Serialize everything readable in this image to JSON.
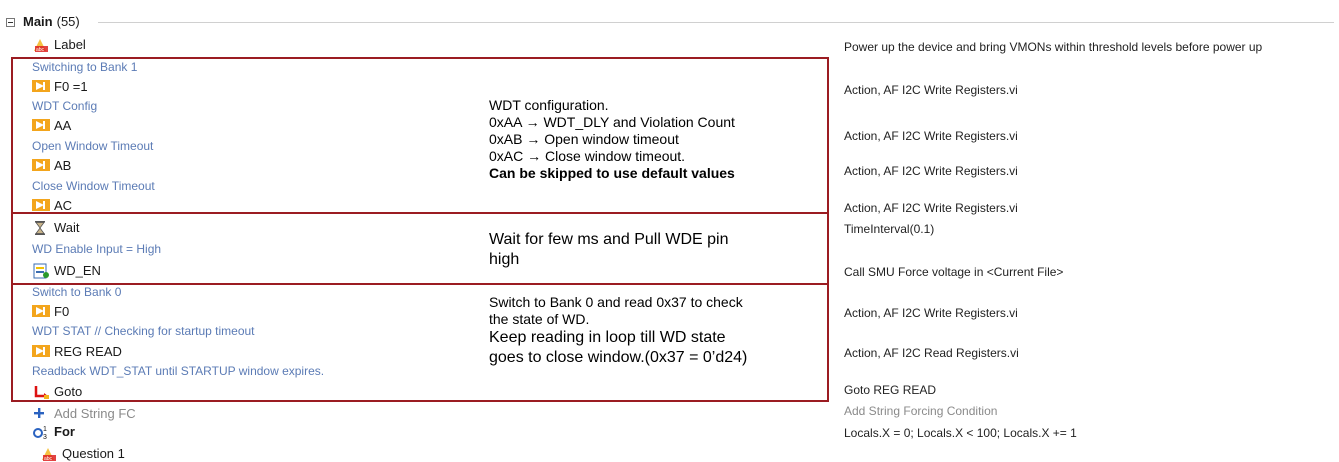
{
  "tree": {
    "top_partial_text": "",
    "main": {
      "label": "Main",
      "count": "(55)"
    },
    "rows": [
      {
        "id": "label",
        "type": "step",
        "icon": "label-icon",
        "text": "Label",
        "right": "Power up the device and bring VMONs within threshold levels before power up"
      },
      {
        "id": "c1",
        "type": "comment",
        "text": "Switching to Bank 1"
      },
      {
        "id": "f0-1",
        "type": "step",
        "icon": "action-icon",
        "text": "F0 =1",
        "right": "Action,  AF I2C Write Registers.vi"
      },
      {
        "id": "c2",
        "type": "comment",
        "text": "WDT Config"
      },
      {
        "id": "aa",
        "type": "step",
        "icon": "action-icon",
        "text": "AA",
        "right": "Action,  AF I2C Write Registers.vi"
      },
      {
        "id": "c3",
        "type": "comment",
        "text": "Open Window Timeout"
      },
      {
        "id": "ab",
        "type": "step",
        "icon": "action-icon",
        "text": "AB",
        "right": "Action,  AF I2C Write Registers.vi"
      },
      {
        "id": "c4",
        "type": "comment",
        "text": "Close Window Timeout"
      },
      {
        "id": "ac",
        "type": "step",
        "icon": "action-icon",
        "text": "AC",
        "right": "Action,  AF I2C Write Registers.vi"
      },
      {
        "id": "wait",
        "type": "step",
        "icon": "hourglass-icon",
        "text": "Wait",
        "right": "TimeInterval(0.1)"
      },
      {
        "id": "c5",
        "type": "comment",
        "text": "WD Enable Input = High"
      },
      {
        "id": "wden",
        "type": "step",
        "icon": "smu-icon",
        "text": "WD_EN",
        "right": "Call SMU Force voltage in <Current File>"
      },
      {
        "id": "c6",
        "type": "comment",
        "text": "Switch to Bank 0"
      },
      {
        "id": "f0",
        "type": "step",
        "icon": "action-icon",
        "text": "F0",
        "right": "Action,  AF I2C Write Registers.vi"
      },
      {
        "id": "c7",
        "type": "comment",
        "text": "WDT STAT // Checking for startup timeout"
      },
      {
        "id": "regread",
        "type": "step",
        "icon": "action-icon",
        "text": "REG READ",
        "right": "Action,  AF I2C Read Registers.vi"
      },
      {
        "id": "c8",
        "type": "comment",
        "text": "Readback WDT_STAT until STARTUP window expires."
      },
      {
        "id": "goto",
        "type": "step",
        "icon": "goto-icon",
        "text": "Goto",
        "right": "Goto REG READ"
      },
      {
        "id": "addfc",
        "type": "add",
        "icon": "plus-icon",
        "text": "Add String FC",
        "right": "Add String Forcing Condition"
      },
      {
        "id": "for",
        "type": "step",
        "icon": "for-loop-icon",
        "text": "For",
        "right": "Locals.X = 0; Locals.X < 100; Locals.X += 1"
      },
      {
        "id": "q1",
        "type": "step",
        "icon": "label-icon",
        "text": "Question 1"
      }
    ]
  },
  "annotations": {
    "wdt": {
      "line1": "WDT configuration.",
      "line2": "0xAA → WDT_DLY and Violation Count",
      "line3": "0xAB → Open window timeout",
      "line4": "0xAC → Close window timeout.",
      "line5": "Can be skipped to use default values"
    },
    "wait": {
      "line1": "Wait for few ms and Pull WDE pin",
      "line2": "high"
    },
    "bank0": {
      "line1": "Switch to Bank 0 and read 0x37 to check",
      "line2": "the state of WD.",
      "line3": "Keep reading in loop till WD state",
      "line4": "goes to close window.(0x37 = 0’d24)"
    }
  },
  "colors": {
    "box_border": "#9b1c22",
    "comment_text": "#5b7bb5",
    "action_icon": "#f0a21a"
  }
}
